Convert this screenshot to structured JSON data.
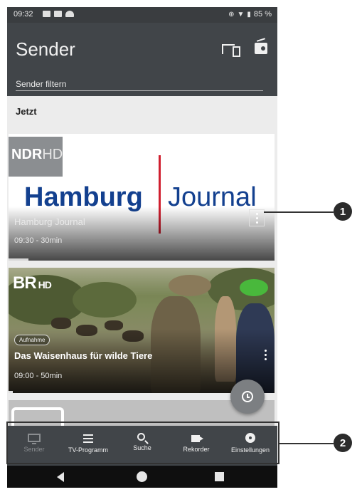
{
  "status_bar": {
    "time": "09:32",
    "battery": "85 %"
  },
  "app_bar": {
    "title": "Sender",
    "filter_placeholder": "Sender filtern",
    "icons": [
      "cast-devices-icon",
      "radio-icon"
    ]
  },
  "section_label": "Jetzt",
  "cards": [
    {
      "logo_main": "NDR",
      "logo_suffix": "HD",
      "brand_bold": "Hamburg",
      "brand_thin": "Journal",
      "title": "Hamburg Journal",
      "time": "09:30 - 30min"
    },
    {
      "logo_main": "BR",
      "logo_suffix": "HD",
      "badge": "Aufnahme",
      "title": "Das Waisenhaus für wilde Tiere",
      "time": "09:00 - 50min"
    }
  ],
  "bottom_nav": {
    "items": [
      {
        "label": "Sender",
        "icon": "tv-icon",
        "active": false
      },
      {
        "label": "TV-Programm",
        "icon": "list-icon",
        "active": true
      },
      {
        "label": "Suche",
        "icon": "search-icon",
        "active": true
      },
      {
        "label": "Rekorder",
        "icon": "video-camera-icon",
        "active": true
      },
      {
        "label": "Einstellungen",
        "icon": "gear-icon",
        "active": true
      }
    ]
  },
  "callouts": [
    "1",
    "2"
  ],
  "colors": {
    "appbar": "#414549",
    "brand_blue": "#13408f",
    "brand_red": "#d01f2f"
  }
}
